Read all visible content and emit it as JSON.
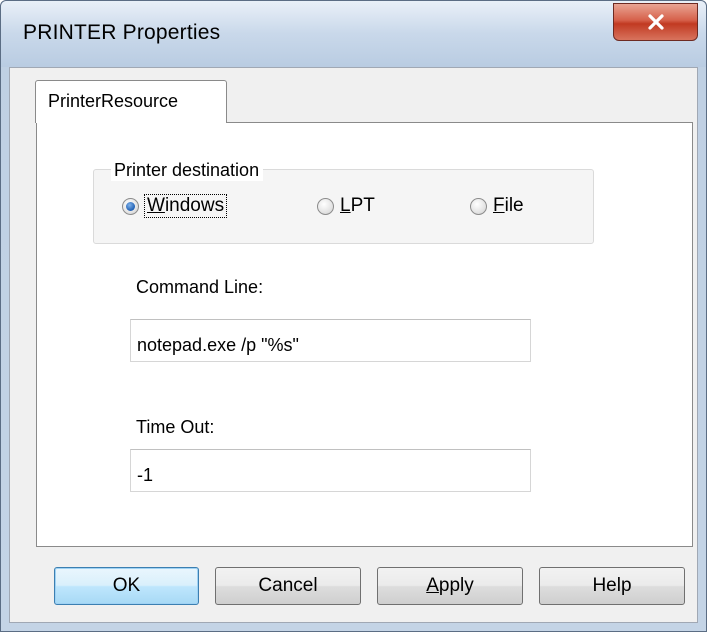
{
  "window": {
    "title": "PRINTER Properties"
  },
  "tabs": [
    {
      "label": "PrinterResource"
    }
  ],
  "printer_destination": {
    "label": "Printer destination",
    "options": [
      {
        "label": "Windows",
        "mnemonic": "W",
        "rest": "indows",
        "checked": true
      },
      {
        "label": "LPT",
        "mnemonic": "L",
        "rest": "PT",
        "checked": false
      },
      {
        "label": "File",
        "mnemonic": "F",
        "rest": "ile",
        "checked": false
      }
    ]
  },
  "command_line": {
    "label": "Command Line:",
    "value": "notepad.exe /p \"%s\""
  },
  "time_out": {
    "label": "Time Out:",
    "value": "-1"
  },
  "buttons": {
    "ok": "OK",
    "cancel": "Cancel",
    "apply_mnemonic": "A",
    "apply_rest": "pply",
    "help": "Help"
  },
  "colors": {
    "accent": "#3c7fb1",
    "close_button": "#c13a22",
    "radio_checked": "#1f5fb3"
  },
  "icons": {
    "close": "close-icon"
  }
}
